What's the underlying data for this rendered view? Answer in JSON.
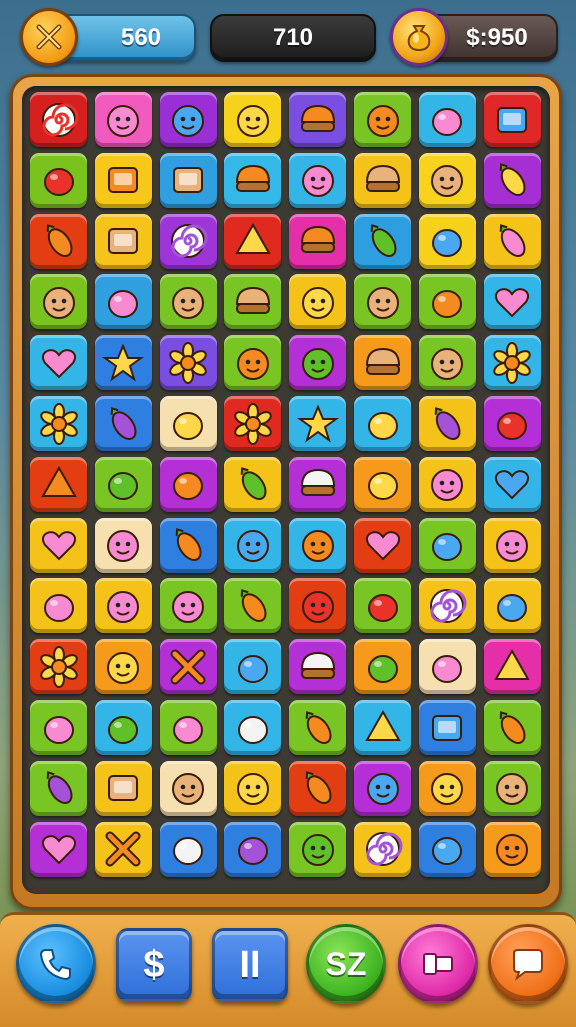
{
  "hud": {
    "left_badge_icon": "crossed-swords-icon",
    "moves": "560",
    "score": "710",
    "right_badge_icon": "gold-bag-icon",
    "coins": "$:950"
  },
  "board": {
    "rows": [
      [
        {
          "color": "#d62020",
          "icon": "swirl-candy-icon"
        },
        {
          "color": "#f15bbf",
          "icon": "pink-smiley-icon"
        },
        {
          "color": "#9b2fd6",
          "icon": "blue-smiley-icon"
        },
        {
          "color": "#f7d21b",
          "icon": "yellow-smiley-icon"
        },
        {
          "color": "#7a4ee0",
          "icon": "pudding-icon"
        },
        {
          "color": "#79c524",
          "icon": "cat-face-icon"
        },
        {
          "color": "#34b5e8",
          "icon": "raspberry-icon"
        },
        {
          "color": "#e02828",
          "icon": "blue-block-icon"
        }
      ],
      [
        {
          "color": "#7ac31e",
          "icon": "apple-icon"
        },
        {
          "color": "#f7c81a",
          "icon": "phone-device-icon"
        },
        {
          "color": "#2f9fe0",
          "icon": "chest-icon"
        },
        {
          "color": "#33b8e8",
          "icon": "ice-cream-icon"
        },
        {
          "color": "#34b5e8",
          "icon": "pig-face-icon"
        },
        {
          "color": "#f5c21a",
          "icon": "burger-icon"
        },
        {
          "color": "#f7d31e",
          "icon": "monkey-face-icon"
        },
        {
          "color": "#a52fd3",
          "icon": "banana-icon"
        }
      ],
      [
        {
          "color": "#e33d14",
          "icon": "carrot-face-icon"
        },
        {
          "color": "#f5c31a",
          "icon": "robot-icon"
        },
        {
          "color": "#9d35d8",
          "icon": "spiral-icon"
        },
        {
          "color": "#e02a20",
          "icon": "cone-icon"
        },
        {
          "color": "#e42fa8",
          "icon": "taco-icon"
        },
        {
          "color": "#2d9fe0",
          "icon": "pepper-icon"
        },
        {
          "color": "#f5d11c",
          "icon": "blue-drop-icon"
        },
        {
          "color": "#f5c21a",
          "icon": "pink-leaf-icon"
        }
      ],
      [
        {
          "color": "#7ac31e",
          "icon": "boy-face-icon"
        },
        {
          "color": "#2f9fe0",
          "icon": "orange-egg-icon"
        },
        {
          "color": "#79c524",
          "icon": "kid-face-icon"
        },
        {
          "color": "#79c524",
          "icon": "burger-icon"
        },
        {
          "color": "#f5c21a",
          "icon": "yellow-smiley-icon"
        },
        {
          "color": "#79c524",
          "icon": "kid-face-icon"
        },
        {
          "color": "#79c524",
          "icon": "orange-fruit-icon"
        },
        {
          "color": "#34b5e8",
          "icon": "heart-icon"
        }
      ],
      [
        {
          "color": "#34b5e8",
          "icon": "pink-heart-icon"
        },
        {
          "color": "#2f7fe0",
          "icon": "star-icon"
        },
        {
          "color": "#7a4ee0",
          "icon": "flower-icon"
        },
        {
          "color": "#79c524",
          "icon": "orange-face-icon"
        },
        {
          "color": "#b42fd6",
          "icon": "green-monster-icon"
        },
        {
          "color": "#f59a1a",
          "icon": "burger-icon"
        },
        {
          "color": "#79c524",
          "icon": "kid-face-icon"
        },
        {
          "color": "#34b5e8",
          "icon": "sunflower-icon"
        }
      ],
      [
        {
          "color": "#34b5e8",
          "icon": "sun-face-icon"
        },
        {
          "color": "#2f7fe0",
          "icon": "eggplant-icon"
        },
        {
          "color": "#f7e0b0",
          "icon": "lemon-icon"
        },
        {
          "color": "#e02a20",
          "icon": "flower-icon"
        },
        {
          "color": "#34b5e8",
          "icon": "star-icon"
        },
        {
          "color": "#34b5e8",
          "icon": "lemon-icon"
        },
        {
          "color": "#f5c21a",
          "icon": "eggplant-icon"
        },
        {
          "color": "#b42fd6",
          "icon": "tomato-icon"
        }
      ],
      [
        {
          "color": "#e33d14",
          "icon": "watermelon-icon"
        },
        {
          "color": "#79c524",
          "icon": "lime-icon"
        },
        {
          "color": "#b42fd6",
          "icon": "orange-bag-icon"
        },
        {
          "color": "#f5c21a",
          "icon": "green-pepper-icon"
        },
        {
          "color": "#b42fd6",
          "icon": "onigiri-icon"
        },
        {
          "color": "#f59a1a",
          "icon": "lemon-icon"
        },
        {
          "color": "#f5c21a",
          "icon": "pig-face-icon"
        },
        {
          "color": "#34b5e8",
          "icon": "blue-heart-icon"
        }
      ],
      [
        {
          "color": "#f5c21a",
          "icon": "pink-heart-icon"
        },
        {
          "color": "#f7e0b0",
          "icon": "pig-face-icon"
        },
        {
          "color": "#2f7fe0",
          "icon": "carrot-icon"
        },
        {
          "color": "#34b5e8",
          "icon": "blue-face-icon"
        },
        {
          "color": "#34b5e8",
          "icon": "cat-face-icon"
        },
        {
          "color": "#e33d14",
          "icon": "pink-heart-icon"
        },
        {
          "color": "#79c524",
          "icon": "blue-drop-icon"
        },
        {
          "color": "#f5c21a",
          "icon": "pink-face-icon"
        }
      ],
      [
        {
          "color": "#f5c21a",
          "icon": "pink-egg-icon"
        },
        {
          "color": "#f5c21a",
          "icon": "pink-face-icon"
        },
        {
          "color": "#79c524",
          "icon": "pink-face-icon"
        },
        {
          "color": "#79c524",
          "icon": "orange-leaf-icon"
        },
        {
          "color": "#e33d14",
          "icon": "red-face-icon"
        },
        {
          "color": "#79c524",
          "icon": "strawberry-icon"
        },
        {
          "color": "#f5c21a",
          "icon": "spiral-icon"
        },
        {
          "color": "#f5c21a",
          "icon": "blue-drop-icon"
        }
      ],
      [
        {
          "color": "#e33d14",
          "icon": "sunflower-icon"
        },
        {
          "color": "#f59a1a",
          "icon": "yellow-blob-icon"
        },
        {
          "color": "#b42fd6",
          "icon": "cross-icon"
        },
        {
          "color": "#34b5e8",
          "icon": "blue-egg-icon"
        },
        {
          "color": "#b42fd6",
          "icon": "onigiri-icon"
        },
        {
          "color": "#f59a1a",
          "icon": "lime-icon"
        },
        {
          "color": "#f7e0b0",
          "icon": "pink-egg-icon"
        },
        {
          "color": "#e42fa8",
          "icon": "cone-icon"
        }
      ],
      [
        {
          "color": "#79c524",
          "icon": "raspberry-icon"
        },
        {
          "color": "#34b5e8",
          "icon": "lime-icon"
        },
        {
          "color": "#79c524",
          "icon": "pink-egg-icon"
        },
        {
          "color": "#34b5e8",
          "icon": "snowball-icon"
        },
        {
          "color": "#79c524",
          "icon": "carrot-face-icon"
        },
        {
          "color": "#34b5e8",
          "icon": "cheese-icon"
        },
        {
          "color": "#2f7fe0",
          "icon": "box-icon"
        },
        {
          "color": "#79c524",
          "icon": "lollipop-icon"
        }
      ],
      [
        {
          "color": "#79c524",
          "icon": "eggplant-icon"
        },
        {
          "color": "#f5c21a",
          "icon": "robot-face-icon"
        },
        {
          "color": "#f7e0b0",
          "icon": "kid-face-icon"
        },
        {
          "color": "#f5c21a",
          "icon": "yellow-smiley-icon"
        },
        {
          "color": "#e33d14",
          "icon": "carrot-icon"
        },
        {
          "color": "#b42fd6",
          "icon": "blue-face-icon"
        },
        {
          "color": "#f59a1a",
          "icon": "yellow-smiley-icon"
        },
        {
          "color": "#79c524",
          "icon": "boy-face-icon"
        }
      ],
      [
        {
          "color": "#b42fd6",
          "icon": "pink-heart-icon"
        },
        {
          "color": "#f5c21a",
          "icon": "cross-icon"
        },
        {
          "color": "#2f7fe0",
          "icon": "ghost-icon"
        },
        {
          "color": "#2f7fe0",
          "icon": "potion-icon"
        },
        {
          "color": "#79c524",
          "icon": "green-monster-icon"
        },
        {
          "color": "#f5c21a",
          "icon": "blue-spiral-icon"
        },
        {
          "color": "#2f7fe0",
          "icon": "blue-drop-icon"
        },
        {
          "color": "#f59a1a",
          "icon": "orange-face-icon"
        }
      ]
    ]
  },
  "bottom_bar": {
    "call_icon": "phone-icon",
    "shop_label": "$",
    "pause_label": "II",
    "score_label": "SZ",
    "booster_icon": "hammer-icon",
    "chat_icon": "chat-bubble-icon"
  },
  "colors": {
    "frame": "#d58a2a",
    "board_bg": "#3d3a33",
    "call_button": "#1a8ee0",
    "shop_button": "#2f6fd8",
    "pause_button": "#2f6fd8",
    "score_button": "#3db520",
    "booster_button": "#e02aa8",
    "chat_button": "#f07018"
  }
}
